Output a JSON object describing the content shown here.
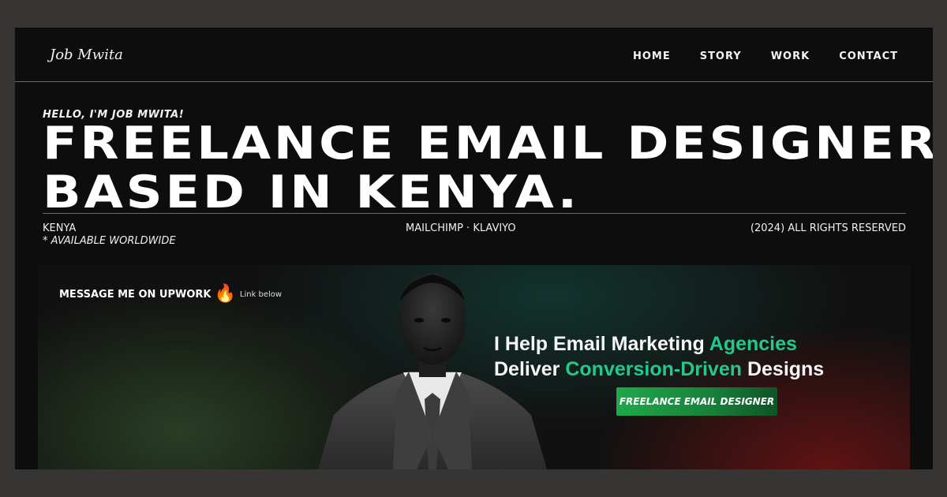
{
  "header": {
    "logo": "Job Mwita",
    "nav": [
      "HOME",
      "STORY",
      "WORK",
      "CONTACT"
    ]
  },
  "hero": {
    "greeting": "HELLO, I'M JOB MWITA!",
    "headline_line1": "FREELANCE EMAIL DESIGNER,",
    "headline_line2": "BASED IN KENYA."
  },
  "meta": {
    "location": "KENYA",
    "availability": "* AVAILABLE WORLDWIDE",
    "tools": "MAILCHIMP · KLAVIYO",
    "copyright": "(2024) ALL RIGHTS RESERVED"
  },
  "banner": {
    "upwork_label": "MESSAGE ME ON UPWORK",
    "fire_icon": "🔥",
    "link_hint": "Link below",
    "tagline_part1": "I Help Email Marketing ",
    "tagline_accent1": "Agencies",
    "tagline_part2": "Deliver ",
    "tagline_accent2": "Conversion-Driven",
    "tagline_part3": " Designs",
    "cta_label": "FREELANCE EMAIL DESIGNER",
    "accent_color": "#22c98a",
    "cta_color": "#1fa84a"
  }
}
